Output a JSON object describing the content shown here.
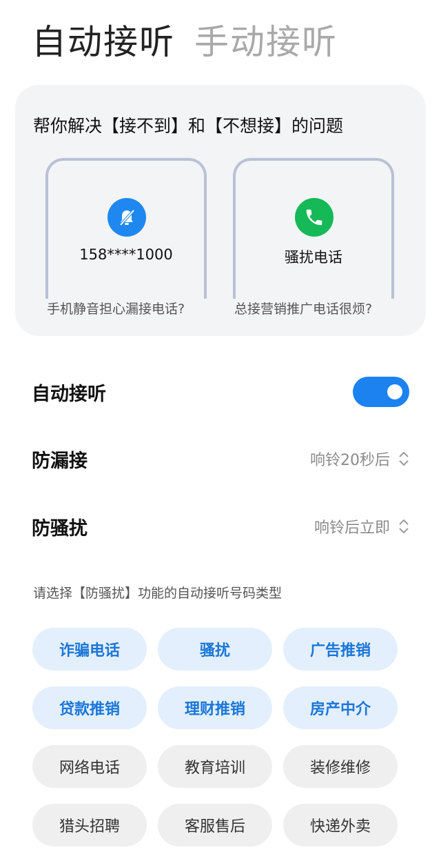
{
  "tabs": [
    {
      "label": "自动接听",
      "active": true
    },
    {
      "label": "手动接听",
      "active": false
    }
  ],
  "intro_card": {
    "title": "帮你解决【接不到】和【不想接】的问题",
    "phone_left": {
      "icon": "bell-muted-icon",
      "text": "158****1000",
      "caption": "手机静音担心漏接电话?"
    },
    "phone_right": {
      "icon": "phone-icon",
      "text": "骚扰电话",
      "caption": "总接营销推广电话很烦?"
    }
  },
  "settings": {
    "auto_answer": {
      "label": "自动接听",
      "enabled": true
    },
    "anti_miss": {
      "label": "防漏接",
      "value": "响铃20秒后"
    },
    "anti_harass": {
      "label": "防骚扰",
      "value": "响铃后立即"
    }
  },
  "hint": "请选择【防骚扰】功能的自动接听号码类型",
  "categories": [
    {
      "label": "诈骗电话",
      "selected": true
    },
    {
      "label": "骚扰",
      "selected": true
    },
    {
      "label": "广告推销",
      "selected": true
    },
    {
      "label": "贷款推销",
      "selected": true
    },
    {
      "label": "理财推销",
      "selected": true
    },
    {
      "label": "房产中介",
      "selected": true
    },
    {
      "label": "网络电话",
      "selected": false
    },
    {
      "label": "教育培训",
      "selected": false
    },
    {
      "label": "装修维修",
      "selected": false
    },
    {
      "label": "猎头招聘",
      "selected": false
    },
    {
      "label": "客服售后",
      "selected": false
    },
    {
      "label": "快递外卖",
      "selected": false
    }
  ],
  "colors": {
    "accent": "#1b82f0",
    "chip_selected_bg": "#e3effc",
    "chip_selected_text": "#1a76d8",
    "green": "#15b957"
  }
}
